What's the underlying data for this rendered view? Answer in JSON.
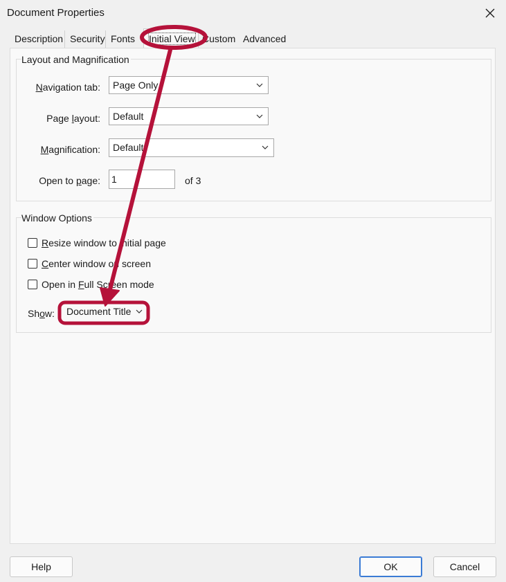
{
  "window": {
    "title": "Document Properties"
  },
  "tabs": [
    {
      "label": "Description"
    },
    {
      "label": "Security"
    },
    {
      "label": "Fonts"
    },
    {
      "label": "Initial View"
    },
    {
      "label": "Custom"
    },
    {
      "label": "Advanced"
    }
  ],
  "active_tab": "Initial View",
  "layout_group": {
    "title": "Layout and Magnification",
    "navigation_tab": {
      "label_pre": "",
      "label_key": "N",
      "label_post": "avigation tab:",
      "value": "Page Only"
    },
    "page_layout": {
      "label_pre": "Page ",
      "label_key": "l",
      "label_post": "ayout:",
      "value": "Default"
    },
    "magnification": {
      "label_pre": "",
      "label_key": "M",
      "label_post": "agnification:",
      "value": "Default"
    },
    "open_to_page": {
      "label_pre": "Open to ",
      "label_key": "p",
      "label_post": "age:",
      "value": "1",
      "of_text": "of 3"
    }
  },
  "window_group": {
    "title": "Window Options",
    "checkboxes": [
      {
        "pre": "",
        "key": "R",
        "post": "esize window to initial page",
        "checked": false
      },
      {
        "pre": "",
        "key": "C",
        "post": "enter window on screen",
        "checked": false
      },
      {
        "pre": "Open in ",
        "key": "F",
        "post": "ull Screen mode",
        "checked": false
      }
    ],
    "show": {
      "label_pre": "Sh",
      "label_key": "o",
      "label_post": "w:",
      "value": "Document Title"
    }
  },
  "buttons": {
    "help": "Help",
    "ok": "OK",
    "cancel": "Cancel"
  },
  "colors": {
    "annotation": "#b5123a",
    "default_button_border": "#3a7bd5"
  },
  "icons": {
    "close": "close-icon",
    "dropdown": "chevron-down-icon"
  }
}
